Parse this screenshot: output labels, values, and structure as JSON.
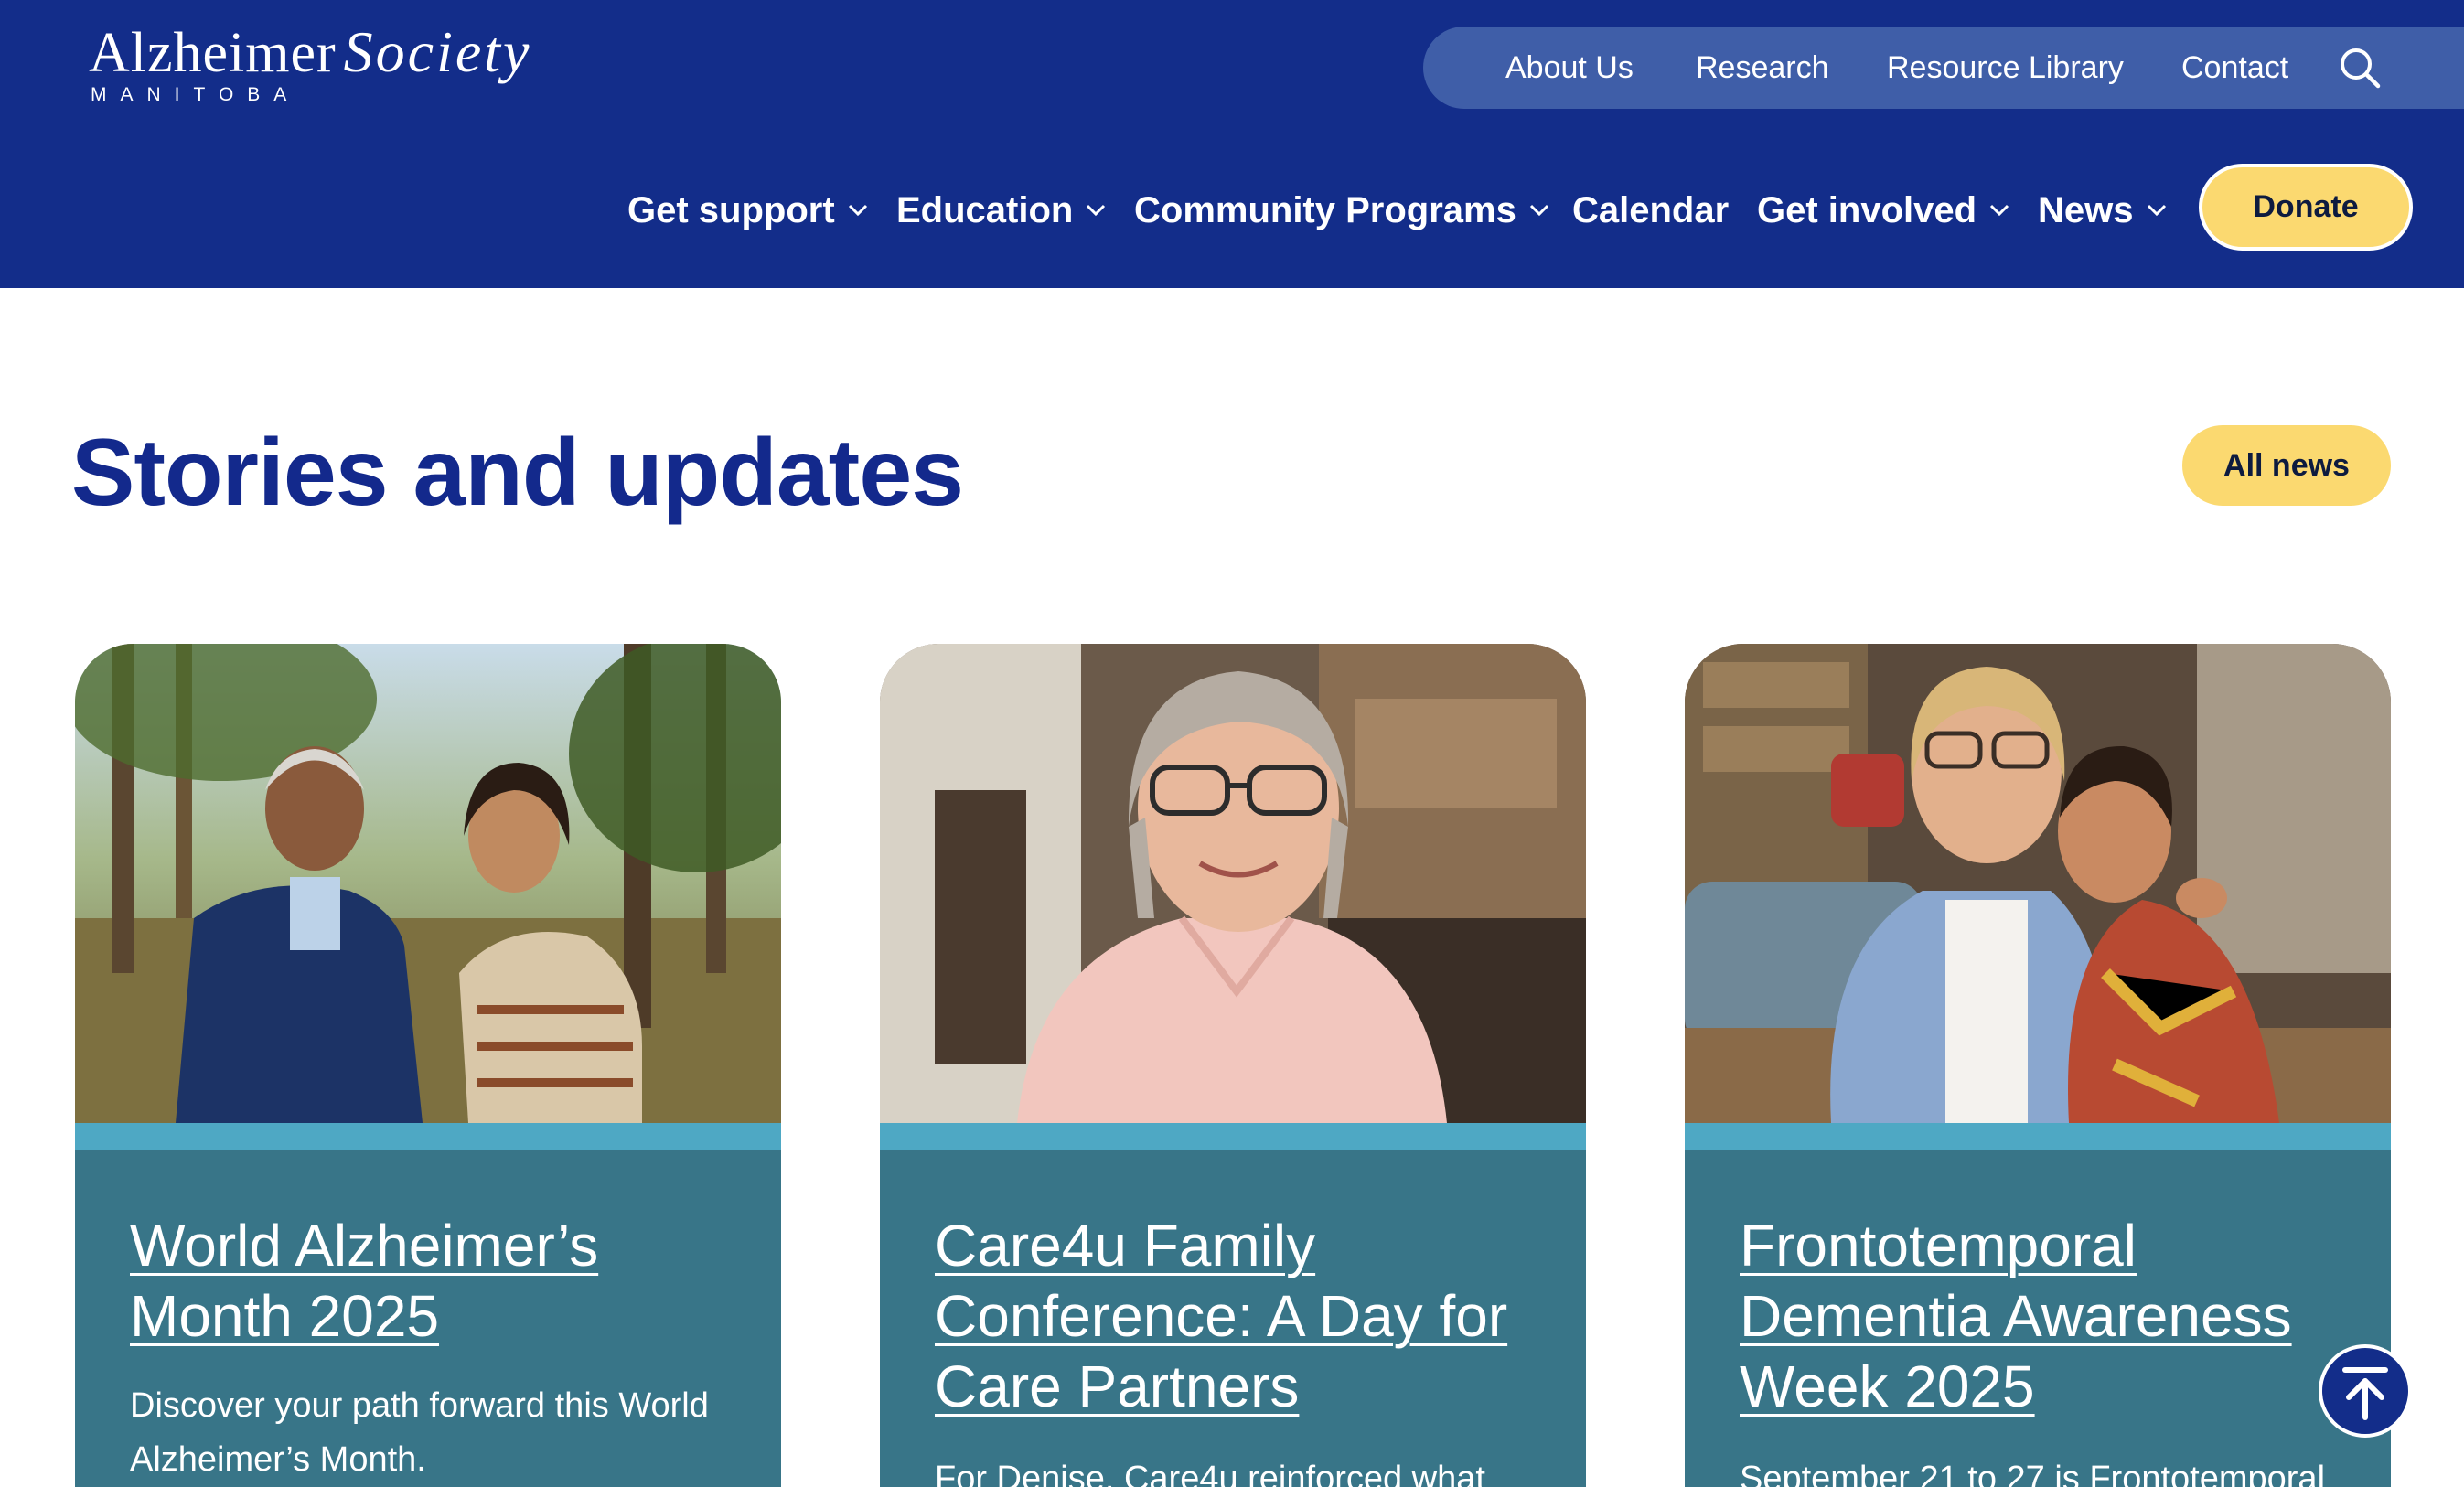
{
  "brand": {
    "name_part1": "Alzheimer",
    "name_part2": "Society",
    "region": "MANITOBA"
  },
  "utility_nav": {
    "items": [
      {
        "label": "About Us"
      },
      {
        "label": "Research"
      },
      {
        "label": "Resource Library"
      },
      {
        "label": "Contact"
      }
    ],
    "search_icon": "search-icon"
  },
  "main_nav": {
    "items": [
      {
        "label": "Get support",
        "has_dropdown": true
      },
      {
        "label": "Education",
        "has_dropdown": true
      },
      {
        "label": "Community Programs",
        "has_dropdown": true
      },
      {
        "label": "Calendar",
        "has_dropdown": false
      },
      {
        "label": "Get involved",
        "has_dropdown": true
      },
      {
        "label": "News",
        "has_dropdown": true
      }
    ],
    "donate_label": "Donate"
  },
  "section": {
    "title": "Stories and updates",
    "all_news_label": "All news"
  },
  "cards": [
    {
      "title": "World Alzheimer’s Month 2025",
      "description": "Discover your path forward this World Alzheimer’s Month."
    },
    {
      "title": "Care4u Family Conference: A Day for Care Partners",
      "description": "For Denise, Care4u reinforced what"
    },
    {
      "title": "Frontotemporal Dementia Awareness Week 2025",
      "description": "September 21 to 27 is Frontotemporal"
    }
  ],
  "colors": {
    "header_bg": "#132d8a",
    "utility_bar_bg": "#3f5ea8",
    "accent_yellow": "#fbd970",
    "card_body": "#387588",
    "card_stripe": "#4ea8c4",
    "title_blue": "#13298c"
  },
  "back_to_top_icon": "arrow-up-to-top-icon"
}
